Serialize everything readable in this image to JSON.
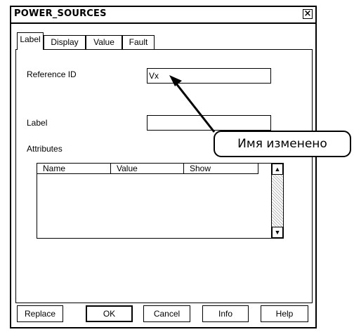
{
  "window": {
    "title": "POWER_SOURCES",
    "close_glyph": "×"
  },
  "tabs": [
    {
      "label": "Label",
      "active": true
    },
    {
      "label": "Display",
      "active": false
    },
    {
      "label": "Value",
      "active": false
    },
    {
      "label": "Fault",
      "active": false
    }
  ],
  "form": {
    "reference_id_label": "Reference ID",
    "reference_id_value": "Vx",
    "label_label": "Label",
    "label_value": "",
    "attributes_label": "Attributes"
  },
  "attributes_table": {
    "columns": [
      "Name",
      "Value",
      "Show"
    ],
    "rows": []
  },
  "buttons": {
    "replace": "Replace",
    "ok": "OK",
    "cancel": "Cancel",
    "info": "Info",
    "help": "Help"
  },
  "annotation": {
    "text": "Имя изменено"
  }
}
